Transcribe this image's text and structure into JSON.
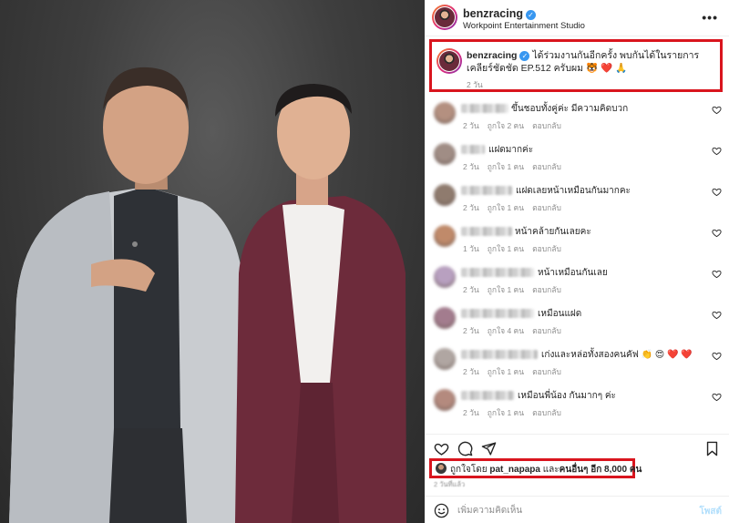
{
  "post": {
    "username": "benzracing",
    "location": "Workpoint Entertainment Studio",
    "more_label": "•••",
    "caption": {
      "username": "benzracing",
      "text": "ได้ร่วมงานกันอีกครั้ง พบกันได้ในรายการเคลียร์ชัดชัด EP.512 ครับผม 🐯 ❤️ 🙏",
      "time": "2 วัน"
    }
  },
  "comments": [
    {
      "text": "ขึ้นชอบทั้งคู่ค่ะ มีความคิดบวก",
      "time": "2 วัน",
      "likes": "ถูกใจ 2 คน",
      "reply": "ตอบกลับ",
      "avatar_color": "#b49080"
    },
    {
      "text": "แฝดมากค่ะ",
      "time": "2 วัน",
      "likes": "ถูกใจ 1 คน",
      "reply": "ตอบกลับ",
      "avatar_color": "#a08d85"
    },
    {
      "text": "แฝดเลยหน้าเหมือนกันมากคะ",
      "time": "2 วัน",
      "likes": "ถูกใจ 1 คน",
      "reply": "ตอบกลับ",
      "avatar_color": "#8f7b6e"
    },
    {
      "text": "หน้าคล้ายกันเลยคะ",
      "time": "1 วัน",
      "likes": "ถูกใจ 1 คน",
      "reply": "ตอบกลับ",
      "avatar_color": "#c08a6a"
    },
    {
      "text": "หน้าเหมือนกันเลย",
      "time": "2 วัน",
      "likes": "ถูกใจ 1 คน",
      "reply": "ตอบกลับ",
      "avatar_color": "#b8a0c0"
    },
    {
      "text": "เหมือนแฝด",
      "time": "2 วัน",
      "likes": "ถูกใจ 4 คน",
      "reply": "ตอบกลับ",
      "avatar_color": "#a37c8e"
    },
    {
      "text": "เก่งและหล่อทั้งสองคนคัฟ 👏 😍 ❤️ ❤️",
      "time": "2 วัน",
      "likes": "ถูกใจ 1 คน",
      "reply": "ตอบกลับ",
      "avatar_color": "#b0a6a2"
    },
    {
      "text": "เหมือนพี่น้อง กันมากๆ ค่ะ",
      "time": "2 วัน",
      "likes": "ถูกใจ 1 คน",
      "reply": "ตอบกลับ",
      "avatar_color": "#b48a7e"
    }
  ],
  "likes_line": {
    "prefix": "ถูกใจโดย",
    "user": "pat_napapa",
    "middle": "และ",
    "others": "คนอื่นๆ อีก 8,000 คน"
  },
  "likes_time": "2 วันที่แล้ว",
  "add_comment": {
    "placeholder": "เพิ่มความคิดเห็น",
    "post_label": "โพสต์"
  },
  "icons": [
    "heart-icon",
    "comment-icon",
    "share-icon",
    "bookmark-icon",
    "emoji-icon",
    "verified-icon",
    "more-icon"
  ],
  "colors": {
    "highlight": "#d9151e",
    "verified": "#3897f0",
    "muted": "#8e8e8e"
  }
}
